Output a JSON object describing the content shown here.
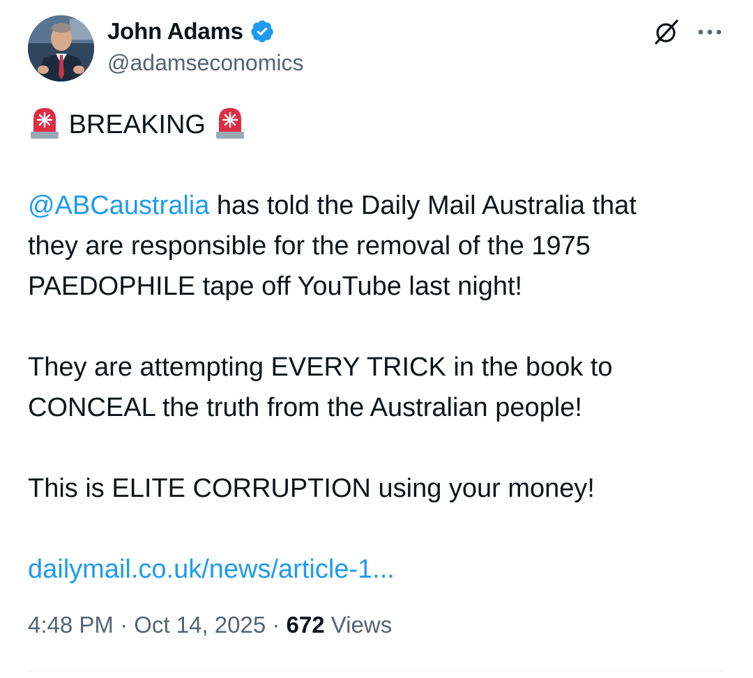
{
  "author": {
    "display_name": "John Adams",
    "handle": "@adamseconomics",
    "verified": true,
    "verified_color": "#1d9bf0"
  },
  "header_actions": {
    "grok_icon": "grok-slash-circle-icon",
    "more_icon": "more-horizontal-icon"
  },
  "tweet": {
    "breaking_label": "BREAKING",
    "siren_icon": "police-car-light-emoji",
    "mention": "@ABCaustralia",
    "para1_after_mention": " has told the Daily Mail Australia that",
    "para1_line2": "they are responsible for the removal of the 1975",
    "para1_line3": "PAEDOPHILE tape off YouTube last night!",
    "para2_line1": "They are attempting EVERY TRICK in the book to",
    "para2_line2": "CONCEAL the truth from the Australian people!",
    "para3_line1": "This is ELITE CORRUPTION using your money!",
    "link_text": "dailymail.co.uk/news/article-1...",
    "link_color": "#1d9bf0"
  },
  "meta": {
    "time": "4:48 PM",
    "separator": " · ",
    "date": "Oct 14, 2025",
    "views_count": "672",
    "views_label": " Views"
  }
}
